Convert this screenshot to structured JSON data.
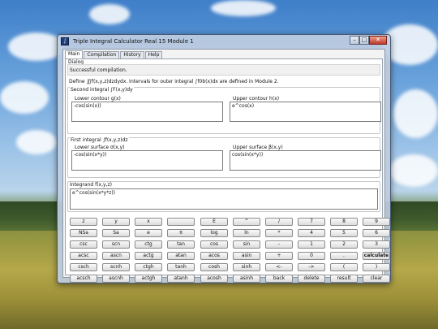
{
  "window": {
    "title": "Triple Integral Calculator Real 15 Module 1",
    "icon_name": "app-icon"
  },
  "tabs": [
    "Main",
    "Compilation",
    "History",
    "Help"
  ],
  "dialog": {
    "label": "Dialog",
    "status": "Successful compilation."
  },
  "define_text": "Define ∭f(x,y,z)dzdydx. Intervals for outer integral ∫f0b(x)dx are defined in Module 2.",
  "second_integral": {
    "label": "Second integral ∫F(x,y)dy",
    "lower_label": "Lower contour g(x)",
    "lower_value": "-cos(sin(x))",
    "upper_label": "Upper contour h(x)",
    "upper_value": "e^cos(x)"
  },
  "first_integral": {
    "label": "First integral ∫f(x,y,z)dz",
    "lower_label": "Lower surface σ(x,y)",
    "lower_value": "-cos(sin(x*y))",
    "upper_label": "Upper surface β(x,y)",
    "upper_value": "cos(sin(x*y))"
  },
  "integrand": {
    "label": "Integrand f(x,y,z)",
    "value": "e^cos(sin(x*y*z))"
  },
  "keypad": {
    "rows": [
      [
        "z",
        "y",
        "x",
        "",
        "E",
        "^",
        "/",
        "7",
        "8",
        "9"
      ],
      [
        "NSa",
        "Sa",
        "e",
        "π",
        "log",
        "ln",
        "*",
        "4",
        "5",
        "6"
      ],
      [
        "csc",
        "scn",
        "ctg",
        "tan",
        "cos",
        "sin",
        "-",
        "1",
        "2",
        "3"
      ],
      [
        "acsc",
        "ascn",
        "actg",
        "atan",
        "acos",
        "asin",
        "+",
        "0",
        ".",
        "calculate"
      ],
      [
        "csch",
        "scnh",
        "ctgh",
        "tanh",
        "cosh",
        "sinh",
        "<-",
        "->",
        "(",
        ")"
      ],
      [
        "acsch",
        "ascnh",
        "actgh",
        "atanh",
        "acosh",
        "asinh",
        "back",
        "delete",
        "result",
        "clear"
      ]
    ]
  }
}
